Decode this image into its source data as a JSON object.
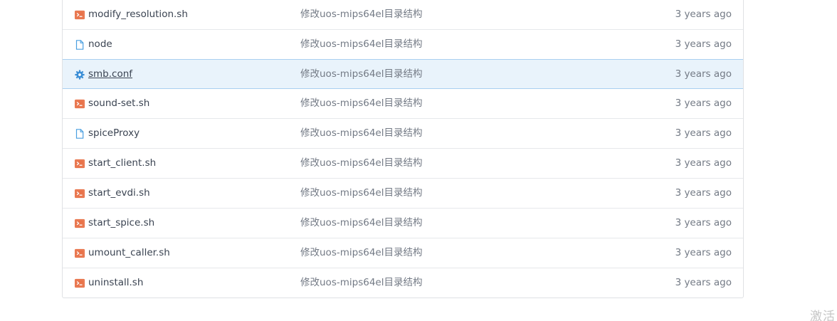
{
  "files": [
    {
      "name": "modify_resolution.sh",
      "icon": "terminal-file-icon",
      "message": "修改uos-mips64el目录结构",
      "time": "3 years ago",
      "highlighted": false
    },
    {
      "name": "node",
      "icon": "file-icon",
      "message": "修改uos-mips64el目录结构",
      "time": "3 years ago",
      "highlighted": false
    },
    {
      "name": "smb.conf",
      "icon": "gear-icon",
      "message": "修改uos-mips64el目录结构",
      "time": "3 years ago",
      "highlighted": true
    },
    {
      "name": "sound-set.sh",
      "icon": "terminal-file-icon",
      "message": "修改uos-mips64el目录结构",
      "time": "3 years ago",
      "highlighted": false
    },
    {
      "name": "spiceProxy",
      "icon": "file-icon",
      "message": "修改uos-mips64el目录结构",
      "time": "3 years ago",
      "highlighted": false
    },
    {
      "name": "start_client.sh",
      "icon": "terminal-file-icon",
      "message": "修改uos-mips64el目录结构",
      "time": "3 years ago",
      "highlighted": false
    },
    {
      "name": "start_evdi.sh",
      "icon": "terminal-file-icon",
      "message": "修改uos-mips64el目录结构",
      "time": "3 years ago",
      "highlighted": false
    },
    {
      "name": "start_spice.sh",
      "icon": "terminal-file-icon",
      "message": "修改uos-mips64el目录结构",
      "time": "3 years ago",
      "highlighted": false
    },
    {
      "name": "umount_caller.sh",
      "icon": "terminal-file-icon",
      "message": "修改uos-mips64el目录结构",
      "time": "3 years ago",
      "highlighted": false
    },
    {
      "name": "uninstall.sh",
      "icon": "terminal-file-icon",
      "message": "修改uos-mips64el目录结构",
      "time": "3 years ago",
      "highlighted": false
    }
  ],
  "watermark": "激活",
  "colors": {
    "terminal_icon": "#e8734a",
    "file_icon": "#4a9fe0",
    "gear_icon": "#3b8ed6",
    "highlight_bg": "#e9f3fb"
  }
}
